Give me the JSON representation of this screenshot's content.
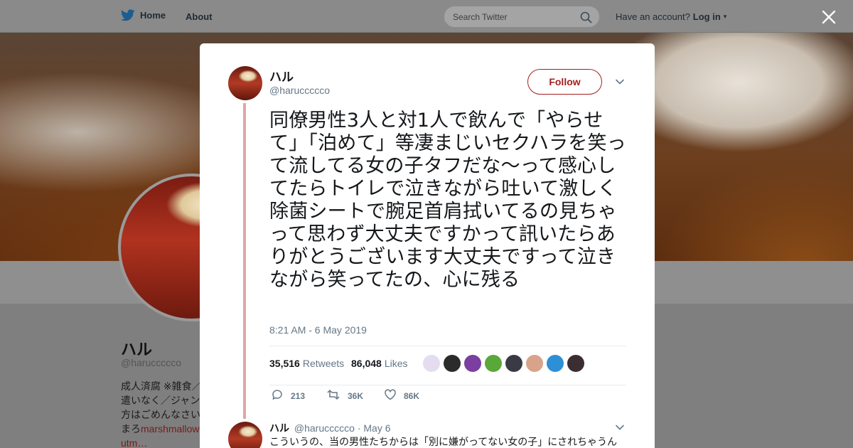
{
  "nav": {
    "home_label": "Home",
    "about_label": "About",
    "search_placeholder": "Search Twitter",
    "account_prompt": "Have an account?",
    "login_label": "Log in",
    "icons": {
      "logo": "twitter-bird-icon",
      "search": "search-icon",
      "login_caret": "caret-down-icon",
      "close": "close-icon"
    }
  },
  "profile": {
    "name": "ハル",
    "handle": "@haruccccco",
    "bio_lines": [
      "成人済腐 ※雑食／",
      "遣いなく／ジャン",
      "方はごめんなさい",
      "まろ",
      "utm…"
    ],
    "bio_link": "marshmallow"
  },
  "tweet": {
    "author_name": "ハル",
    "author_handle": "@haruccccco",
    "follow_label": "Follow",
    "text": "同僚男性3人と対1人で飲んで「やらせて」「泊めて」等凄まじいセクハラを笑って流してる女の子タフだな〜って感心してたらトイレで泣きながら吐いて激しく除菌シートで腕足首肩拭いてるの見ちゃって思わず大丈夫ですかって訊いたらありがとうございます大丈夫ですって泣きながら笑ってたの、心に残る",
    "timestamp": "8:21 AM - 6 May 2019",
    "retweets_count": "35,516",
    "retweets_label": "Retweets",
    "likes_count": "86,048",
    "likes_label": "Likes",
    "liker_avatar_colors": [
      "#e6dcef",
      "#2b2b2b",
      "#7a3fa0",
      "#5aa83a",
      "#3a3a44",
      "#d9a28a",
      "#2d8fd6",
      "#3b2e33"
    ],
    "actions": {
      "reply_count": "213",
      "retweet_count": "36K",
      "like_count": "86K"
    },
    "accent_color": "#a41e1e"
  },
  "reply": {
    "author_name": "ハル",
    "author_handle": "@haruccccco",
    "date": "· May 6",
    "text": "こういうの、当の男性たちからは「別に嫌がってない女の子」にされちゃうん"
  }
}
